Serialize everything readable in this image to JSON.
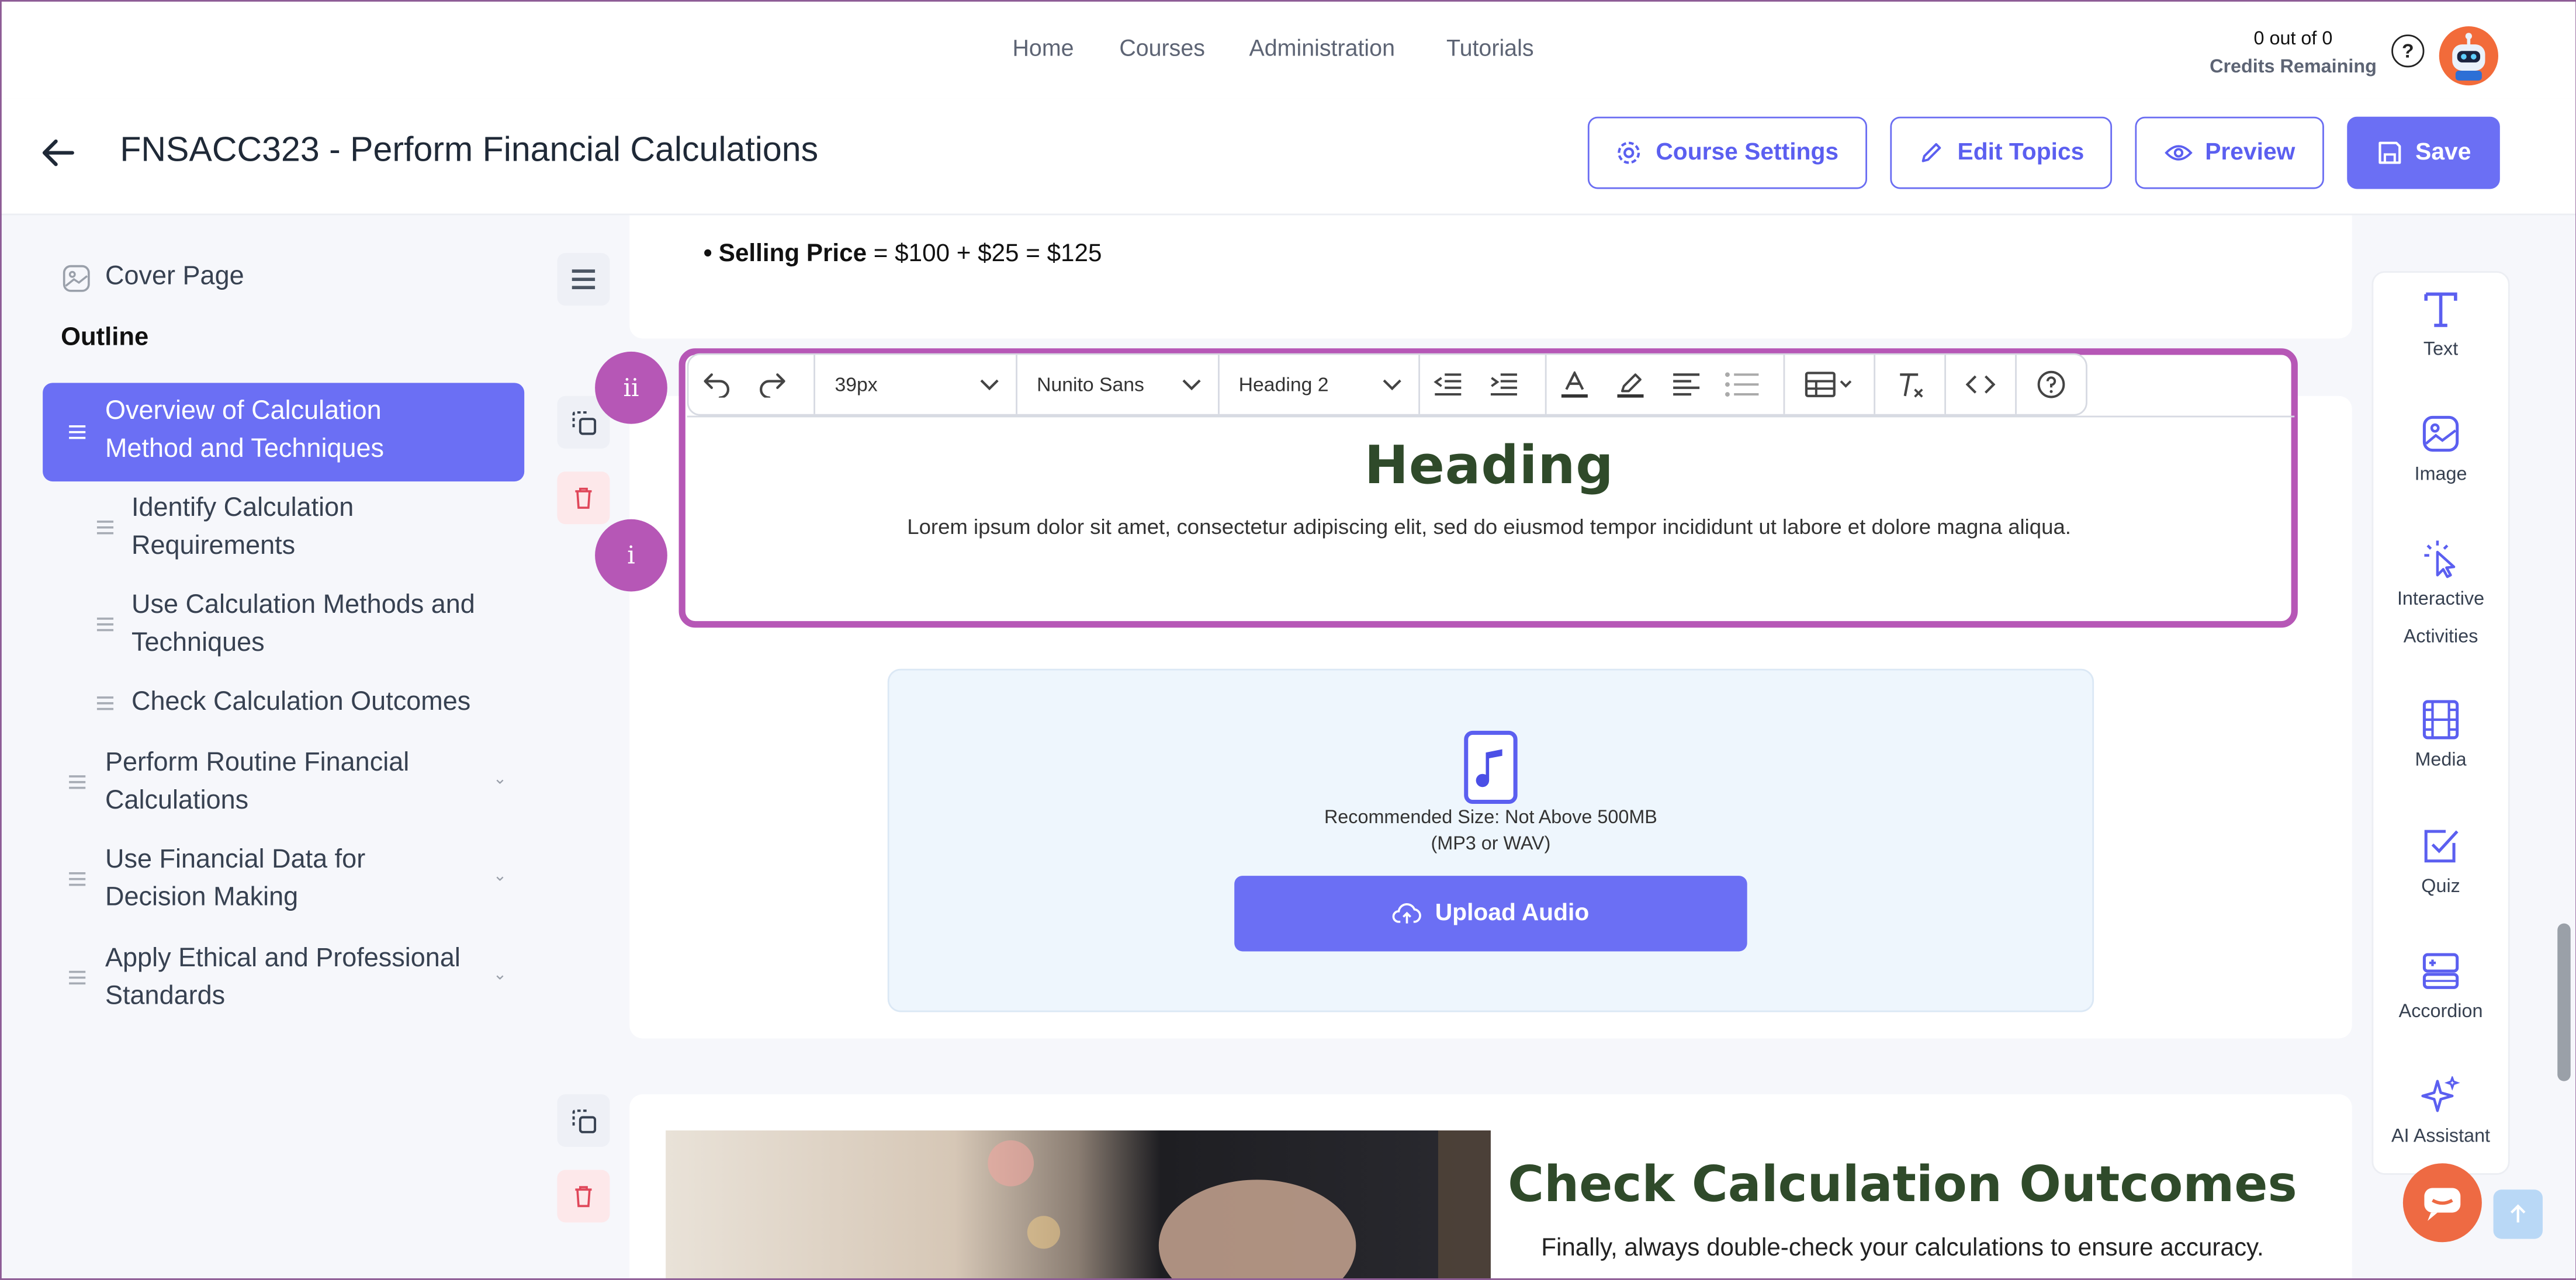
{
  "nav": {
    "links": [
      "Home",
      "Courses",
      "Administration",
      "Tutorials"
    ],
    "credits_count": "0 out of 0",
    "credits_label": "Credits Remaining",
    "help": "?"
  },
  "header": {
    "title": "FNSACC323 - Perform Financial Calculations",
    "buttons": {
      "course_settings": "Course Settings",
      "edit_topics": "Edit Topics",
      "preview": "Preview",
      "save": "Save"
    }
  },
  "sidebar": {
    "cover_page": "Cover Page",
    "outline_label": "Outline",
    "items": [
      {
        "line1": "Overview of Calculation",
        "line2": "Method and Techniques"
      },
      {
        "line1": "Identify Calculation",
        "line2": "Requirements"
      },
      {
        "line1": "Use Calculation Methods and",
        "line2": "Techniques"
      },
      {
        "line1": "Check Calculation Outcomes",
        "line2": ""
      },
      {
        "line1": "Perform Routine Financial",
        "line2": "Calculations"
      },
      {
        "line1": "Use Financial Data for",
        "line2": "Decision Making"
      },
      {
        "line1": "Apply Ethical and Professional",
        "line2": "Standards"
      }
    ]
  },
  "content": {
    "bullet_label": "Selling Price",
    "bullet_equals": " = ",
    "bullet_value": "$100 + $25 = $125",
    "badges": {
      "top": "ii",
      "bottom": "i"
    },
    "toolbar": {
      "font_size": "39px",
      "font_family": "Nunito Sans",
      "block_style": "Heading 2"
    },
    "heading": "Heading",
    "lorem": "Lorem ipsum dolor sit amet, consectetur adipiscing elit, sed do eiusmod tempor incididunt ut labore et dolore magna aliqua.",
    "upload": {
      "size_note": "Recommended Size: Not Above 500MB",
      "format_note": "(MP3 or WAV)",
      "button": "Upload Audio"
    },
    "next_section": {
      "title": "Check Calculation Outcomes",
      "text": "Finally, always double-check your calculations to ensure accuracy."
    }
  },
  "rail": {
    "items": [
      {
        "line1": "Text",
        "line2": ""
      },
      {
        "line1": "Image",
        "line2": ""
      },
      {
        "line1": "Interactive",
        "line2": "Activities"
      },
      {
        "line1": "Media",
        "line2": ""
      },
      {
        "line1": "Quiz",
        "line2": ""
      },
      {
        "line1": "Accordion",
        "line2": ""
      },
      {
        "line1": "AI Assistant",
        "line2": ""
      }
    ]
  },
  "colors": {
    "accent": "#6b6ff4",
    "highlight": "#b657b6",
    "heading_green": "#2f4a2a",
    "danger": "#e0475a"
  },
  "icons": [
    "back-arrow-icon",
    "gear-icon",
    "pencil-icon",
    "eye-icon",
    "save-disk-icon",
    "image-icon",
    "drag-lines-icon",
    "chevron-down-icon",
    "menu-icon",
    "duplicate-icon",
    "trash-icon",
    "undo-icon",
    "redo-icon",
    "outdent-icon",
    "indent-icon",
    "text-color-icon",
    "highlighter-icon",
    "align-left-icon",
    "bullet-list-icon",
    "table-icon",
    "clear-format-icon",
    "code-icon",
    "help-icon",
    "music-file-icon",
    "cloud-upload-icon",
    "text-icon",
    "interactive-pointer-icon",
    "film-icon",
    "quiz-check-icon",
    "accordion-icon",
    "sparkles-icon",
    "chat-icon",
    "arrow-up-icon"
  ]
}
